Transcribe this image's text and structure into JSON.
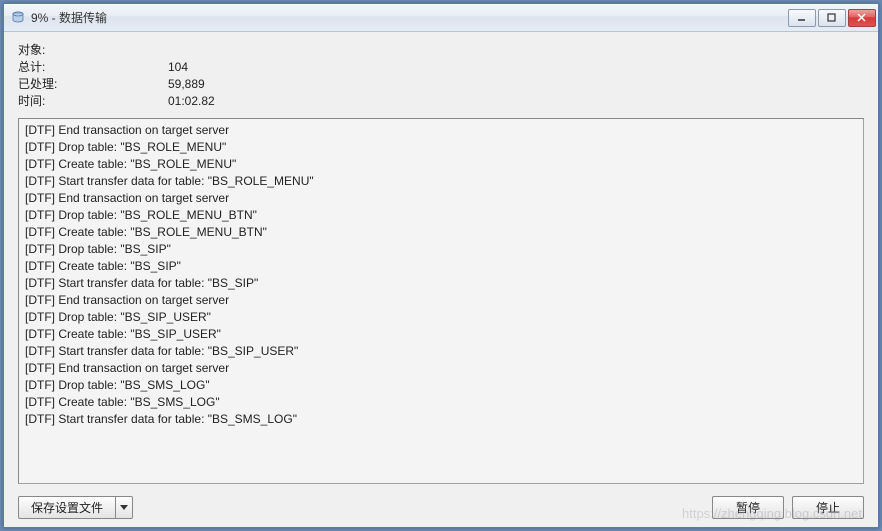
{
  "window": {
    "title": "9% - 数据传输"
  },
  "stats": {
    "object_label": "对象:",
    "object_value": "",
    "total_label": "总计:",
    "total_value": "104",
    "processed_label": "已处理:",
    "processed_value": "59,889",
    "time_label": "时间:",
    "time_value": "01:02.82"
  },
  "log": [
    "[DTF] End transaction on target server",
    "[DTF] Drop table: \"BS_ROLE_MENU\"",
    "[DTF] Create table: \"BS_ROLE_MENU\"",
    "[DTF] Start transfer data for table: \"BS_ROLE_MENU\"",
    "[DTF] End transaction on target server",
    "[DTF] Drop table: \"BS_ROLE_MENU_BTN\"",
    "[DTF] Create table: \"BS_ROLE_MENU_BTN\"",
    "[DTF] Drop table: \"BS_SIP\"",
    "[DTF] Create table: \"BS_SIP\"",
    "[DTF] Start transfer data for table: \"BS_SIP\"",
    "[DTF] End transaction on target server",
    "[DTF] Drop table: \"BS_SIP_USER\"",
    "[DTF] Create table: \"BS_SIP_USER\"",
    "[DTF] Start transfer data for table: \"BS_SIP_USER\"",
    "[DTF] End transaction on target server",
    "[DTF] Drop table: \"BS_SMS_LOG\"",
    "[DTF] Create table: \"BS_SMS_LOG\"",
    "[DTF] Start transfer data for table: \"BS_SMS_LOG\""
  ],
  "buttons": {
    "save_settings": "保存设置文件",
    "pause": "暂停",
    "stop": "停止"
  },
  "watermark": "https://zhengqing.blog.csdn.net"
}
